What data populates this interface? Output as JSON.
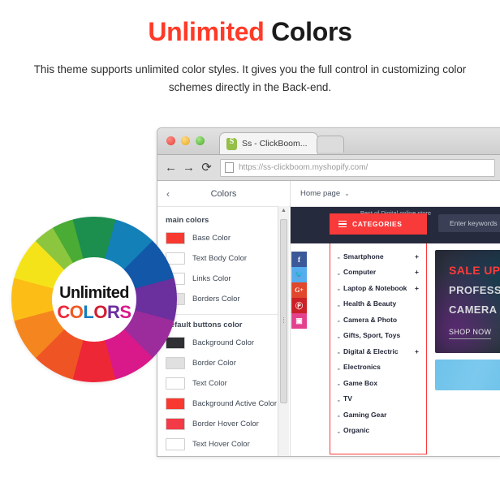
{
  "heading": {
    "accent_word": "Unlimited",
    "plain_word": "Colors",
    "accent_color": "#ff3a28"
  },
  "subtext": "This theme supports unlimited color styles. It gives you the full control in customizing color schemes directly in the Back-end.",
  "browser": {
    "traffic_lights": [
      "close-red",
      "minimize-yellow",
      "maximize-green"
    ],
    "tab_title": "Ss - ClickBoom...",
    "tab_favicon": "shopify-icon",
    "nav": {
      "back": "←",
      "forward": "→",
      "reload": "⟳"
    },
    "url": "https://ss-clickboom.myshopify.com/"
  },
  "sidebar": {
    "back_icon": "‹",
    "title": "Colors",
    "groups": [
      {
        "label": "main colors",
        "rows": [
          {
            "label": "Base Color",
            "swatch": "#f8392f"
          },
          {
            "label": "Text Body Color",
            "swatch": "#ffffff"
          },
          {
            "label": "Links Color",
            "swatch": "#ffffff"
          },
          {
            "label": "Borders Color",
            "swatch": "#e3e3e3"
          }
        ]
      },
      {
        "label": "default buttons color",
        "rows": [
          {
            "label": "Background Color",
            "swatch": "#2f3034"
          },
          {
            "label": "Border Color",
            "swatch": "#e0e0e0"
          },
          {
            "label": "Text Color",
            "swatch": "#ffffff"
          },
          {
            "label": "Background Active Color",
            "swatch": "#f8392f"
          },
          {
            "label": "Border Hover Color",
            "swatch": "#f23b46"
          },
          {
            "label": "Text Hover Color",
            "swatch": "#ffffff"
          }
        ]
      }
    ],
    "scrollbar": {
      "up": "▲",
      "down": "▼"
    }
  },
  "preview": {
    "page_selector": "Home page",
    "page_caret": "⌄",
    "store": {
      "announcement": "Best of Digital online store",
      "categories_button": "CATEGORIES",
      "categories_icon": "hamburger-icon",
      "search_placeholder": "Enter keywords",
      "social": [
        {
          "name": "facebook-icon",
          "glyph": "f",
          "color": "#3b5998"
        },
        {
          "name": "twitter-icon",
          "glyph": "🐦",
          "color": "#55acee"
        },
        {
          "name": "google-plus-icon",
          "glyph": "G+",
          "color": "#e0472c"
        },
        {
          "name": "pinterest-icon",
          "glyph": "Ⓟ",
          "color": "#cb2027"
        },
        {
          "name": "instagram-icon",
          "glyph": "▣",
          "color": "#e4418d"
        }
      ],
      "categories": [
        {
          "name": "Smartphone",
          "expandable": "+"
        },
        {
          "name": "Computer",
          "expandable": "+"
        },
        {
          "name": "Laptop & Notebook",
          "expandable": "+"
        },
        {
          "name": "Health & Beauty",
          "expandable": ""
        },
        {
          "name": "Camera & Photo",
          "expandable": ""
        },
        {
          "name": "Gifts, Sport, Toys",
          "expandable": ""
        },
        {
          "name": "Digital & Electric",
          "expandable": "+"
        },
        {
          "name": "Electronics",
          "expandable": ""
        },
        {
          "name": "Game Box",
          "expandable": ""
        },
        {
          "name": "TV",
          "expandable": ""
        },
        {
          "name": "Gaming Gear",
          "expandable": ""
        },
        {
          "name": "Organic",
          "expandable": ""
        }
      ],
      "hero_banner": {
        "line1": "SALE UP",
        "line2": "PROFESSIONAL",
        "line3": "CAMERA",
        "cta": "SHOP NOW"
      }
    }
  },
  "color_wheel": {
    "title_top": "Unlimited",
    "title_bottom_letters": [
      {
        "char": "C",
        "color": "#ee2737"
      },
      {
        "char": "O",
        "color": "#f05a23"
      },
      {
        "char": "L",
        "color": "#0b7fc0"
      },
      {
        "char": "O",
        "color": "#cf1f31"
      },
      {
        "char": "R",
        "color": "#6b2f9e"
      },
      {
        "char": "S",
        "color": "#d9188a"
      }
    ],
    "segments": [
      "#1c8f4e",
      "#1380b8",
      "#1257a8",
      "#6b2f9e",
      "#9c2b9c",
      "#d9188a",
      "#ee2737",
      "#ef5524",
      "#f5851f",
      "#fbbd16",
      "#f5e31a",
      "#8cc63e"
    ]
  }
}
